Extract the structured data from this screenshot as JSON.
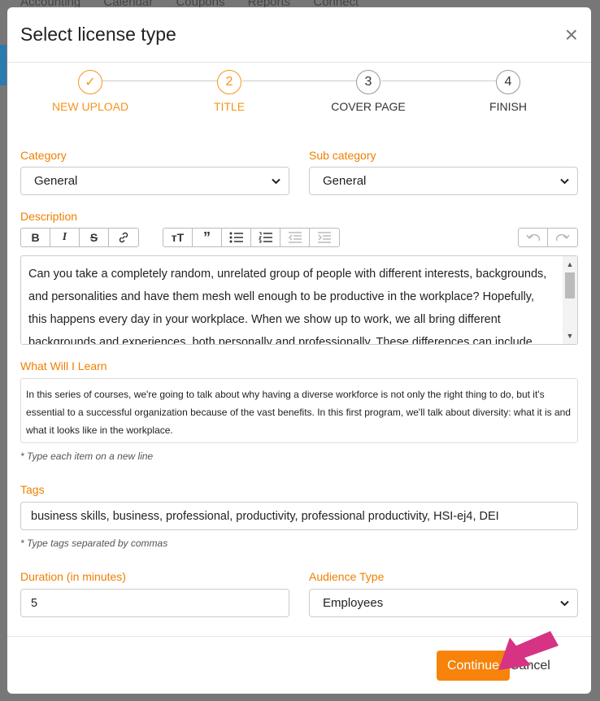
{
  "backdrop": {
    "nav": [
      "Accounting",
      "Calendar",
      "Coupons",
      "Reports",
      "Connect"
    ]
  },
  "modal": {
    "title": "Select license type",
    "close_glyph": "×"
  },
  "steps": [
    {
      "number": "✓",
      "label": "NEW UPLOAD",
      "state": "done"
    },
    {
      "number": "2",
      "label": "TITLE",
      "state": "current"
    },
    {
      "number": "3",
      "label": "COVER PAGE",
      "state": "pending"
    },
    {
      "number": "4",
      "label": "FINISH",
      "state": "pending"
    }
  ],
  "form": {
    "category": {
      "label": "Category",
      "value": "General"
    },
    "subcategory": {
      "label": "Sub category",
      "value": "General"
    },
    "description": {
      "label": "Description",
      "text": "Can you take a completely random, unrelated group of people with different interests, backgrounds, and personalities and have them mesh well enough to be productive in the workplace? Hopefully, this happens every day in your workplace. When we show up to work, we all bring different backgrounds and experiences, both personally and professionally. These differences can include upbringing, ethnicity,"
    },
    "toolbar": {
      "format": [
        "bold-icon",
        "italic-icon",
        "strikethrough-icon",
        "link-icon"
      ],
      "blocks": [
        "text-size-icon",
        "quote-icon",
        "bullet-list-icon",
        "numbered-list-icon",
        "outdent-icon",
        "indent-icon"
      ],
      "history": [
        "undo-icon",
        "redo-icon"
      ]
    },
    "learn": {
      "label": "What Will I Learn",
      "text": "In this series of courses, we're going to talk about why having a diverse workforce is not only the right thing to do, but it's essential to a successful organization because of the vast benefits. In this first program, we'll talk about diversity: what it is and what it looks like in the workplace.",
      "hint": "* Type each item on a new line"
    },
    "tags": {
      "label": "Tags",
      "value": "business skills, business, professional, productivity, professional productivity, HSI-ej4, DEI",
      "hint": "* Type tags separated by commas"
    },
    "duration": {
      "label": "Duration (in minutes)",
      "value": "5"
    },
    "audience": {
      "label": "Audience Type",
      "value": "Employees"
    }
  },
  "footer": {
    "continue": "Continue",
    "cancel": "Cancel"
  },
  "colors": {
    "accent": "#f7830b",
    "label": "#f07f00",
    "arrow": "#d63384"
  }
}
